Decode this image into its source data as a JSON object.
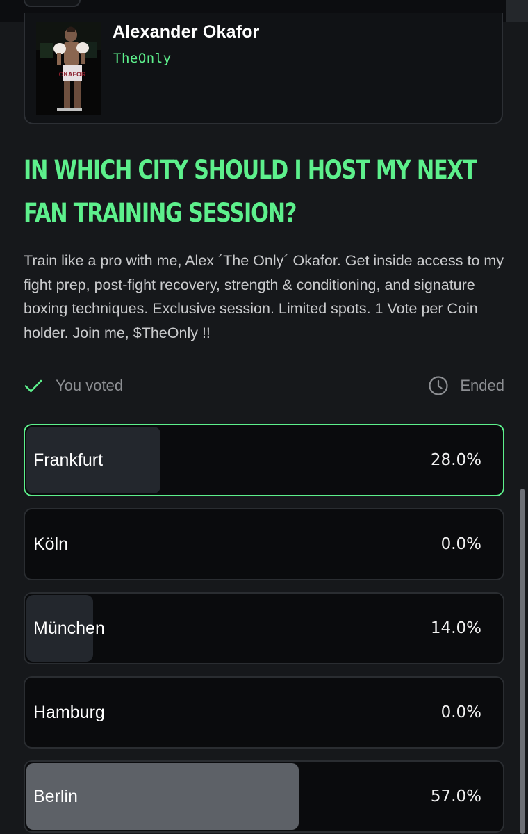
{
  "creator": {
    "name": "Alexander Okafor",
    "handle": "TheOnly",
    "photo_caption": "OKAFOR"
  },
  "poll": {
    "title": "In which city should I host my next fan training session?",
    "description": "Train like a pro with me, Alex ´The Only´ Okafor. Get inside access to my fight prep, post-fight recovery, strength & conditioning, and signature boxing techniques.  Exclusive session. Limited spots. 1 Vote per Coin holder.  Join me, $TheOnly !!",
    "voted_status": "You voted",
    "end_status": "Ended",
    "options": [
      {
        "label": "Frankfurt",
        "percent_text": "28.0%",
        "percent": 28.0,
        "selected": true
      },
      {
        "label": "Köln",
        "percent_text": "0.0%",
        "percent": 0.0,
        "selected": false
      },
      {
        "label": "München",
        "percent_text": "14.0%",
        "percent": 14.0,
        "selected": false
      },
      {
        "label": "Hamburg",
        "percent_text": "0.0%",
        "percent": 0.0,
        "selected": false
      },
      {
        "label": "Berlin",
        "percent_text": "57.0%",
        "percent": 57.0,
        "selected": false,
        "leading": true
      }
    ]
  },
  "icons": {
    "voted": "check-icon",
    "ended": "clock-icon"
  },
  "colors": {
    "accent": "#5df08c",
    "background": "#16181b",
    "card": "#0a0b0d",
    "fill": "#23272d",
    "fill_leading": "#5d6167",
    "muted_text": "#8d8f93"
  }
}
